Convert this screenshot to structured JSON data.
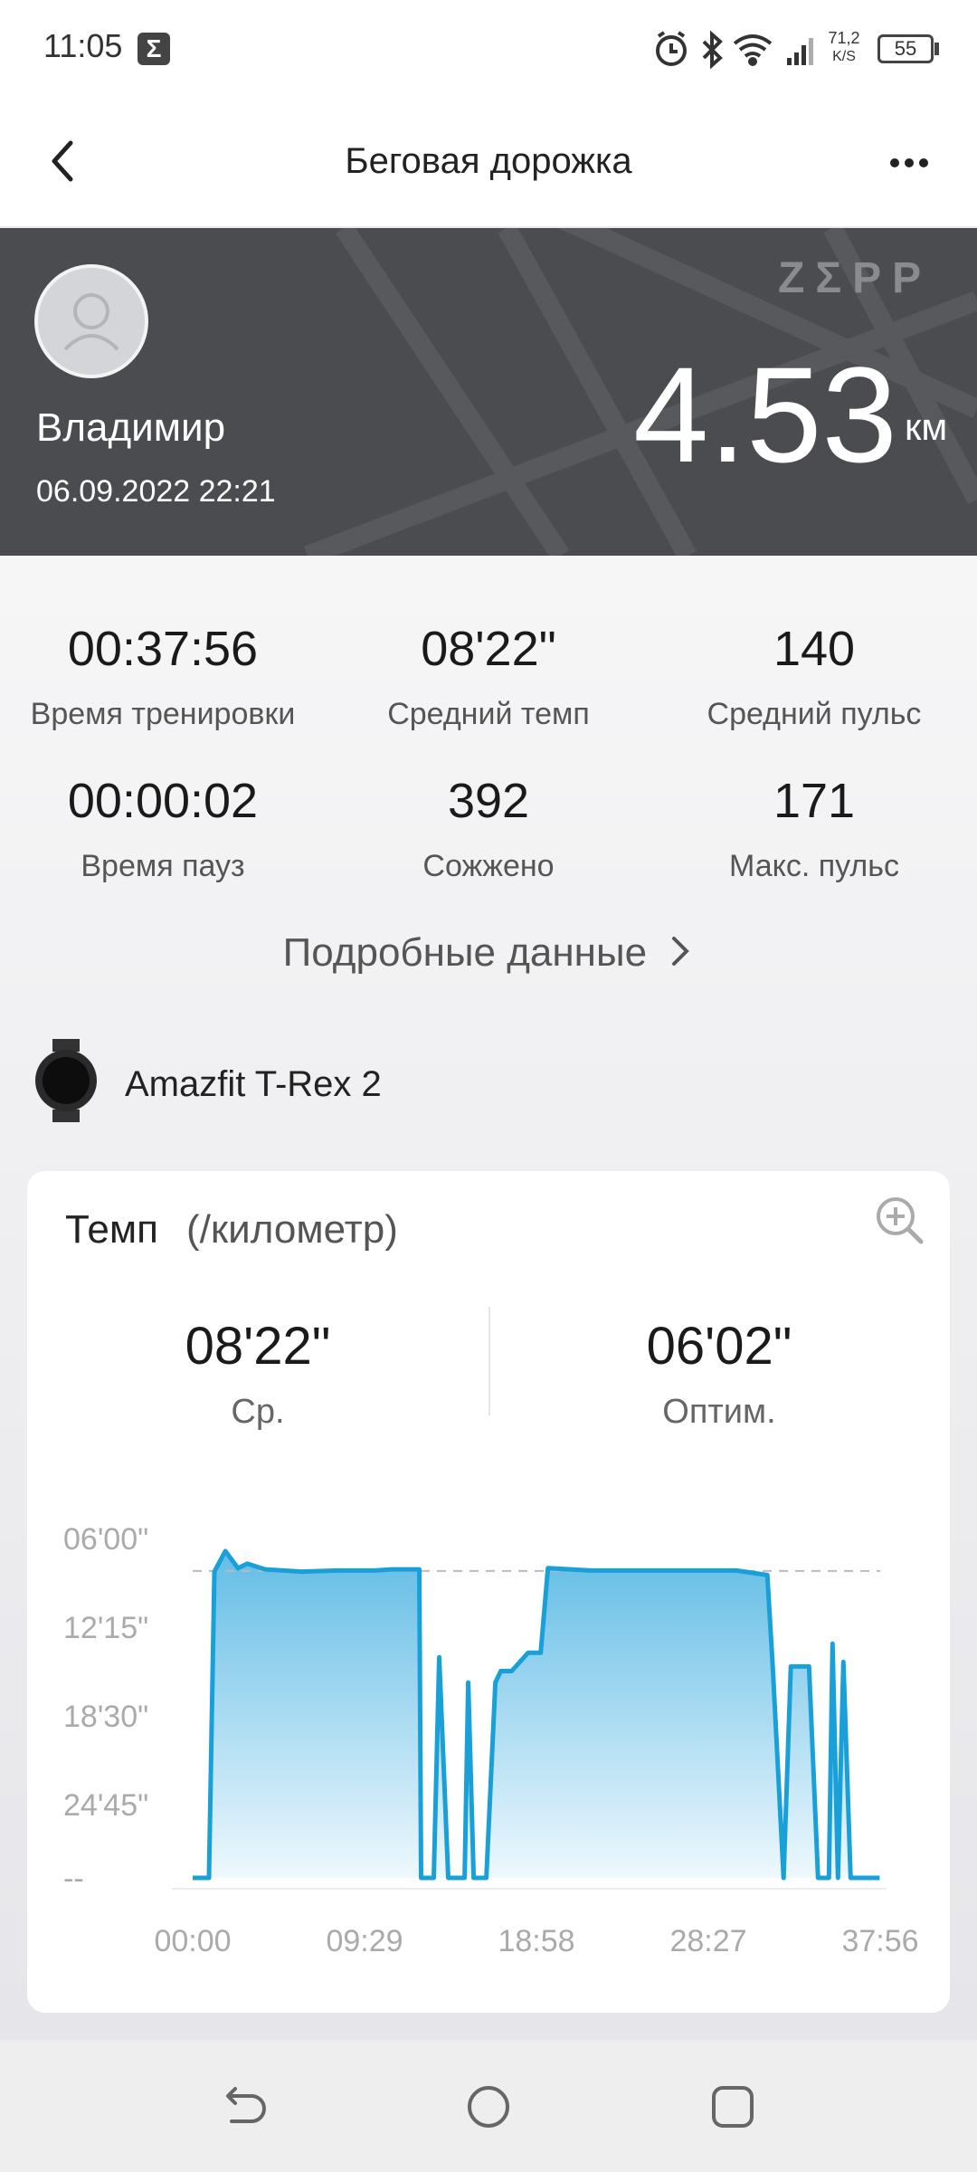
{
  "status_bar": {
    "time": "11:05",
    "net_speed_top": "71,2",
    "net_speed_bottom": "K/S",
    "battery": "55"
  },
  "app_bar": {
    "title": "Беговая дорожка"
  },
  "header": {
    "user_name": "Владимир",
    "datetime": "06.09.2022 22:21",
    "brand": "ZΣPP",
    "distance": "4.53",
    "distance_unit": "км"
  },
  "stats": [
    {
      "value": "00:37:56",
      "label": "Время тренировки"
    },
    {
      "value": "08'22\"",
      "label": "Средний темп"
    },
    {
      "value": "140",
      "label": "Средний пульс"
    },
    {
      "value": "00:00:02",
      "label": "Время пауз"
    },
    {
      "value": "392",
      "label": "Сожжено"
    },
    {
      "value": "171",
      "label": "Макс. пульс"
    }
  ],
  "details_link": "Подробные данные",
  "device": {
    "name": "Amazfit T-Rex 2"
  },
  "pace_card": {
    "title": "Темп",
    "unit": "(/километр)",
    "avg_value": "08'22\"",
    "avg_label": "Ср.",
    "best_value": "06'02\"",
    "best_label": "Оптим."
  },
  "chart_data": {
    "type": "area",
    "y_tick_labels": [
      "06'00\"",
      "12'15\"",
      "18'30\"",
      "24'45\"",
      "--"
    ],
    "x_tick_labels": [
      "00:00",
      "09:29",
      "18:58",
      "28:27",
      "37:56"
    ],
    "x_unit": "minutes elapsed",
    "y_unit": "seconds per km (lower axis position = slower)",
    "ylim": [
      360,
      1845
    ],
    "xlim": [
      0,
      37.93
    ],
    "average_line": 502,
    "series": [
      {
        "x": [
          0,
          0.9,
          1.2,
          1.8,
          2.5,
          3.0,
          4.0,
          5.0,
          6.0,
          8.0,
          10.0,
          11.0,
          12.5,
          12.6,
          13.3,
          13.6,
          14.1,
          15.0,
          15.2,
          15.5,
          16.2,
          16.7,
          17.0,
          17.6,
          18.5,
          19.2,
          19.6,
          22.0,
          26.0,
          30.0,
          31.7,
          32.0,
          32.6,
          33.0,
          33.4,
          34.0,
          34.5,
          35.1,
          35.3,
          35.6,
          35.9,
          36.3,
          37.9
        ],
        "y": [
          1845,
          1845,
          505,
          415,
          490,
          470,
          495,
          500,
          505,
          500,
          500,
          495,
          495,
          1845,
          1845,
          880,
          1845,
          1845,
          990,
          1845,
          1845,
          990,
          940,
          940,
          860,
          860,
          490,
          500,
          500,
          500,
          520,
          920,
          1845,
          920,
          920,
          920,
          1845,
          1845,
          820,
          1845,
          900,
          1845,
          1845
        ]
      }
    ]
  }
}
